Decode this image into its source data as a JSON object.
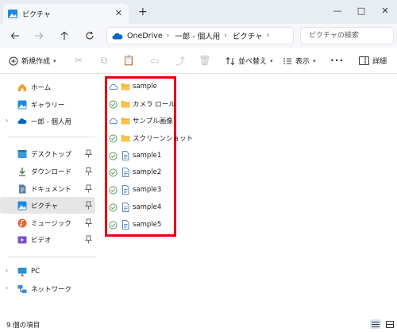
{
  "window": {
    "tab_title": "ピクチャ",
    "new_tab_symbol": "+",
    "close_symbol": "✕",
    "minimize_symbol": "—",
    "maximize_symbol": "□"
  },
  "address": {
    "breadcrumbs": [
      "OneDrive",
      "一郎 - 個人用",
      "ピクチャ"
    ],
    "separator": "›",
    "search_placeholder": "ピクチャの検索"
  },
  "toolbar": {
    "new_label": "新規作成",
    "sort_label": "並べ替え",
    "view_label": "表示",
    "more_label": "•••",
    "details_label": "詳細"
  },
  "sidebar": {
    "quick": [
      {
        "label": "ホーム",
        "icon": "home-icon"
      },
      {
        "label": "ギャラリー",
        "icon": "gallery-icon"
      },
      {
        "label": "一郎 - 個人用",
        "icon": "cloud-icon"
      }
    ],
    "pinned": [
      {
        "label": "デスクトップ",
        "icon": "desktop-icon"
      },
      {
        "label": "ダウンロード",
        "icon": "download-icon"
      },
      {
        "label": "ドキュメント",
        "icon": "documents-icon"
      },
      {
        "label": "ピクチャ",
        "icon": "pictures-icon",
        "selected": true
      },
      {
        "label": "ミュージック",
        "icon": "music-icon"
      },
      {
        "label": "ビデオ",
        "icon": "video-icon"
      }
    ],
    "devices": [
      {
        "label": "PC",
        "icon": "pc-icon"
      },
      {
        "label": "ネットワーク",
        "icon": "network-icon"
      }
    ]
  },
  "files": [
    {
      "name": "sample",
      "type": "folder",
      "status": "cloud"
    },
    {
      "name": "カメラ ロール",
      "type": "folder",
      "status": "synced"
    },
    {
      "name": "サンプル画像",
      "type": "folder",
      "status": "cloud"
    },
    {
      "name": "スクリーンショット",
      "type": "folder",
      "status": "synced"
    },
    {
      "name": "sample1",
      "type": "file",
      "status": "synced"
    },
    {
      "name": "sample2",
      "type": "file",
      "status": "synced"
    },
    {
      "name": "sample3",
      "type": "file",
      "status": "synced"
    },
    {
      "name": "sample4",
      "type": "file",
      "status": "synced"
    },
    {
      "name": "sample5",
      "type": "file",
      "status": "synced"
    }
  ],
  "status": {
    "item_count": "9 個の項目"
  },
  "colors": {
    "accent": "#0067c0",
    "highlight_box": "#e60012",
    "folder": "#f8c34a",
    "synced": "#2e8b3a"
  }
}
